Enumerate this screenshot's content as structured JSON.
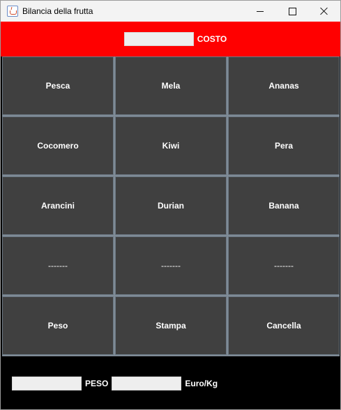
{
  "window": {
    "title": "Bilancia della frutta",
    "colors": {
      "top_panel": "#ff0000",
      "button_bg": "#404040",
      "bottom_panel": "#000000"
    }
  },
  "top": {
    "cost_value": "",
    "cost_label": "COSTO"
  },
  "keys": [
    "Pesca",
    "Mela",
    "Ananas",
    "Cocomero",
    "Kiwi",
    "Pera",
    "Arancini",
    "Durian",
    "Banana",
    "-------",
    "-------",
    "-------",
    "Peso",
    "Stampa",
    "Cancella"
  ],
  "bottom": {
    "weight_value": "",
    "weight_label": "PESO",
    "price_value": "",
    "price_label": "Euro/Kg"
  }
}
